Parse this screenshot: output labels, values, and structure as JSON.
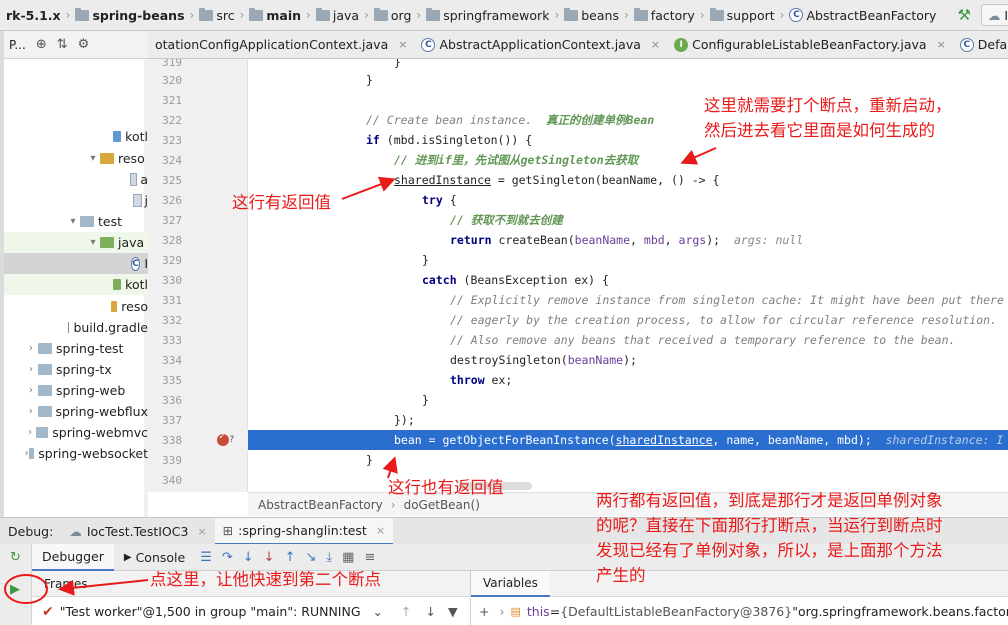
{
  "breadcrumb": [
    {
      "label": "rk-5.1.x",
      "bold": true,
      "icon": "none"
    },
    {
      "label": "spring-beans",
      "bold": true,
      "icon": "folder-icon"
    },
    {
      "label": "src",
      "bold": false,
      "icon": "folder-icon"
    },
    {
      "label": "main",
      "bold": true,
      "icon": "folder-icon"
    },
    {
      "label": "java",
      "bold": false,
      "icon": "folder-icon"
    },
    {
      "label": "org",
      "bold": false,
      "icon": "folder-icon"
    },
    {
      "label": "springframework",
      "bold": false,
      "icon": "folder-icon"
    },
    {
      "label": "beans",
      "bold": false,
      "icon": "folder-icon"
    },
    {
      "label": "factory",
      "bold": false,
      "icon": "folder-icon"
    },
    {
      "label": "support",
      "bold": false,
      "icon": "folder-icon"
    },
    {
      "label": "AbstractBeanFactory",
      "bold": false,
      "icon": "class-icon"
    }
  ],
  "run_config": "IocTest.Test",
  "project_toolbar": {
    "label": "P..."
  },
  "tree": [
    {
      "label": "kotl",
      "indent": 100,
      "icon": "blue",
      "arrow": ""
    },
    {
      "label": "reso",
      "indent": 82,
      "icon": "orange",
      "arrow": "▾"
    },
    {
      "label": "a",
      "indent": 118,
      "icon": "file",
      "arrow": ""
    },
    {
      "label": "j",
      "indent": 118,
      "icon": "file",
      "arrow": ""
    },
    {
      "label": "test",
      "indent": 62,
      "icon": "folder",
      "arrow": "▾"
    },
    {
      "label": "java",
      "indent": 82,
      "icon": "green",
      "arrow": "▾"
    },
    {
      "label": "I",
      "indent": 118,
      "icon": "class",
      "arrow": ""
    },
    {
      "label": "kotl",
      "indent": 100,
      "icon": "green",
      "arrow": ""
    },
    {
      "label": "reso",
      "indent": 100,
      "icon": "orange",
      "arrow": ""
    },
    {
      "label": "build.gradle",
      "indent": 62,
      "icon": "gradle",
      "arrow": ""
    },
    {
      "label": "spring-test",
      "indent": 20,
      "icon": "folder",
      "arrow": "›"
    },
    {
      "label": "spring-tx",
      "indent": 20,
      "icon": "folder",
      "arrow": "›"
    },
    {
      "label": "spring-web",
      "indent": 20,
      "icon": "folder",
      "arrow": "›"
    },
    {
      "label": "spring-webflux",
      "indent": 20,
      "icon": "folder",
      "arrow": "›"
    },
    {
      "label": "spring-webmvc",
      "indent": 20,
      "icon": "folder",
      "arrow": "›"
    },
    {
      "label": "spring-websocket",
      "indent": 20,
      "icon": "folder",
      "arrow": "›"
    }
  ],
  "editor_tabs": [
    {
      "label": "otationConfigApplicationContext.java",
      "icon": "class"
    },
    {
      "label": "AbstractApplicationContext.java",
      "icon": "class"
    },
    {
      "label": "ConfigurableListableBeanFactory.java",
      "icon": "interface"
    },
    {
      "label": "DefaultListableBeanF",
      "icon": "class"
    }
  ],
  "code": {
    "l319": {
      "num": "319",
      "text": "\t\t\t\t}"
    },
    "l320": {
      "num": "320",
      "text": "\t\t\t}"
    },
    "l321": {
      "num": "321"
    },
    "l322": {
      "num": "322",
      "c1": "// Create bean instance.  ",
      "c2": "真正的创建单例Bean"
    },
    "l323": {
      "num": "323",
      "kw": "if",
      "rest": " (mbd.isSingleton()) {"
    },
    "l324": {
      "num": "324",
      "c": "// 进到if里，先试图从getSingleton去获取"
    },
    "l325": {
      "num": "325",
      "u": "sharedInstance",
      "rest": " = getSingleton(beanName, () -> {"
    },
    "l326": {
      "num": "326",
      "kw": "try",
      "rest": " {"
    },
    "l327": {
      "num": "327",
      "c": "// 获取不到就去创建"
    },
    "l328": {
      "num": "328",
      "kw": "return",
      "a": " createBean(",
      "p1": "beanName",
      "b": ", ",
      "p2": "mbd",
      "c": ", ",
      "p3": "args",
      "d": ");",
      "hint": "args: null"
    },
    "l329": {
      "num": "329",
      "text": "}"
    },
    "l330": {
      "num": "330",
      "kw": "catch",
      "rest": " (BeansException ex) {"
    },
    "l331": {
      "num": "331",
      "c": "// Explicitly remove instance from singleton cache: It might have been put there"
    },
    "l332": {
      "num": "332",
      "c": "// eagerly by the creation process, to allow for circular reference resolution."
    },
    "l333": {
      "num": "333",
      "c": "// Also remove any beans that received a temporary reference to the bean."
    },
    "l334": {
      "num": "334",
      "a": "destroySingleton(",
      "p": "beanName",
      "b": ");"
    },
    "l335": {
      "num": "335",
      "kw": "throw",
      "rest": " ex;"
    },
    "l336": {
      "num": "336",
      "text": "}"
    },
    "l337": {
      "num": "337",
      "text": "});"
    },
    "l338": {
      "num": "338",
      "a": "bean = getObjectForBeanInstance(",
      "u": "sharedInstance",
      "b": ", name, beanName, mbd);",
      "hint": "sharedInstance: I"
    },
    "l339": {
      "num": "339",
      "text": "}"
    },
    "l340": {
      "num": "340"
    }
  },
  "editor_breadcrumb": {
    "cls": "AbstractBeanFactory",
    "method": "doGetBean()"
  },
  "debug": {
    "label": "Debug:",
    "tab1": "IocTest.TestIOC3",
    "tab2": ":spring-shanglin:test",
    "debugger_tab": "Debugger",
    "console_tab": "Console",
    "frames_label": "Frames",
    "thread": "\"Test worker\"@1,500 in group \"main\": RUNNING",
    "variables_label": "Variables",
    "var_name": "this",
    "var_eq": " = ",
    "var_value": "{DefaultListableBeanFactory@3876}",
    "var_rest": " \"org.springframework.beans.factory.su"
  },
  "annotations": {
    "top_line1": "这里就需要打个断点，重新启动，",
    "top_line2": "然后进去看它里面是如何生成的",
    "left": "这行有返回值",
    "mid": "这行也有返回值",
    "right_line1": "两行都有返回值，到底是那行才是返回单例对象",
    "right_line2": "的呢？直接在下面那行打断点，当运行到断点时",
    "right_line3": "发现已经有了单例对象，所以，是上面那个方法",
    "right_line4": "产生的",
    "bottom": "点这里，让他快速到第二个断点"
  },
  "colors": {
    "annotation": "#e81a1a",
    "breakpoint_line": "#2a6fd0",
    "keyword": "#000080",
    "comment": "#808080",
    "green_comment": "#629755"
  }
}
